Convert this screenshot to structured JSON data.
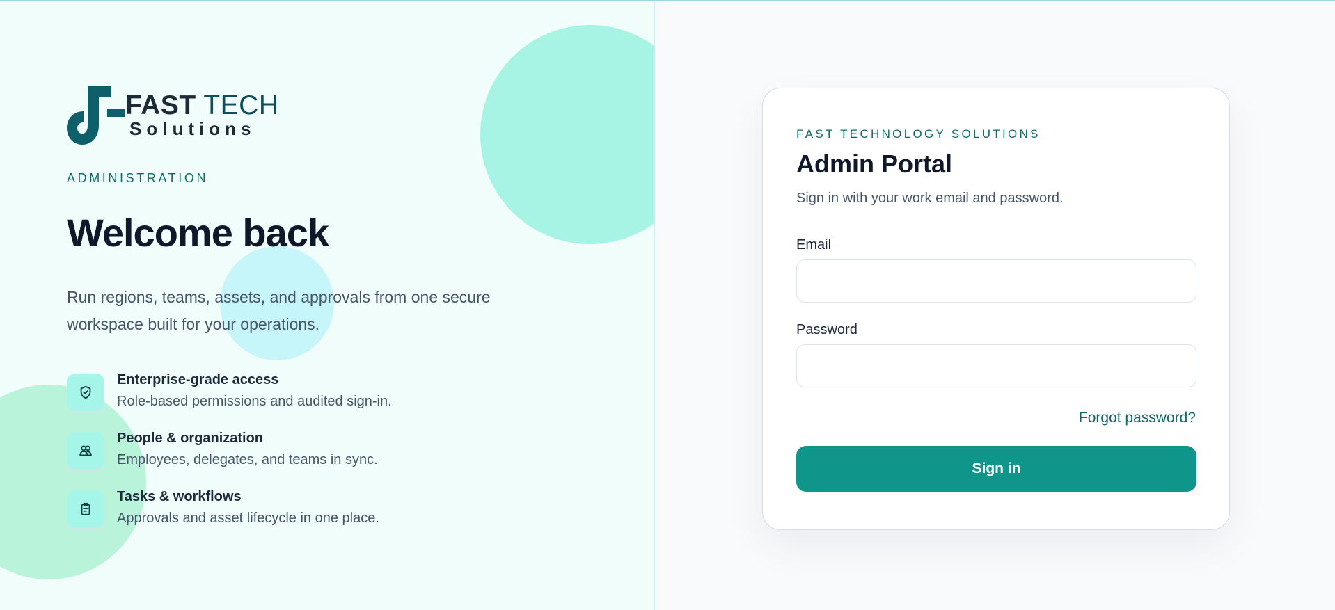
{
  "brand": {
    "logo_word_bold": "FAST",
    "logo_word_light": "TECH",
    "logo_sub": "Solutions",
    "colors": {
      "accent": "#10958a",
      "dark": "#0f172a",
      "teal_text": "#0f6b6b"
    }
  },
  "hero": {
    "eyebrow": "ADMINISTRATION",
    "title": "Welcome back",
    "lead": "Run regions, teams, assets, and approvals from one secure workspace built for your operations."
  },
  "features": [
    {
      "icon": "shield-check-icon",
      "title": "Enterprise-grade access",
      "desc": "Role-based permissions and audited sign-in."
    },
    {
      "icon": "users-icon",
      "title": "People & organization",
      "desc": "Employees, delegates, and teams in sync."
    },
    {
      "icon": "clipboard-icon",
      "title": "Tasks & workflows",
      "desc": "Approvals and asset lifecycle in one place."
    }
  ],
  "login": {
    "eyebrow": "FAST TECHNOLOGY SOLUTIONS",
    "title": "Admin Portal",
    "subtitle": "Sign in with your work email and password.",
    "email_label": "Email",
    "email_value": "",
    "email_placeholder": "",
    "password_label": "Password",
    "password_value": "",
    "password_placeholder": "",
    "forgot_label": "Forgot password?",
    "submit_label": "Sign in"
  }
}
